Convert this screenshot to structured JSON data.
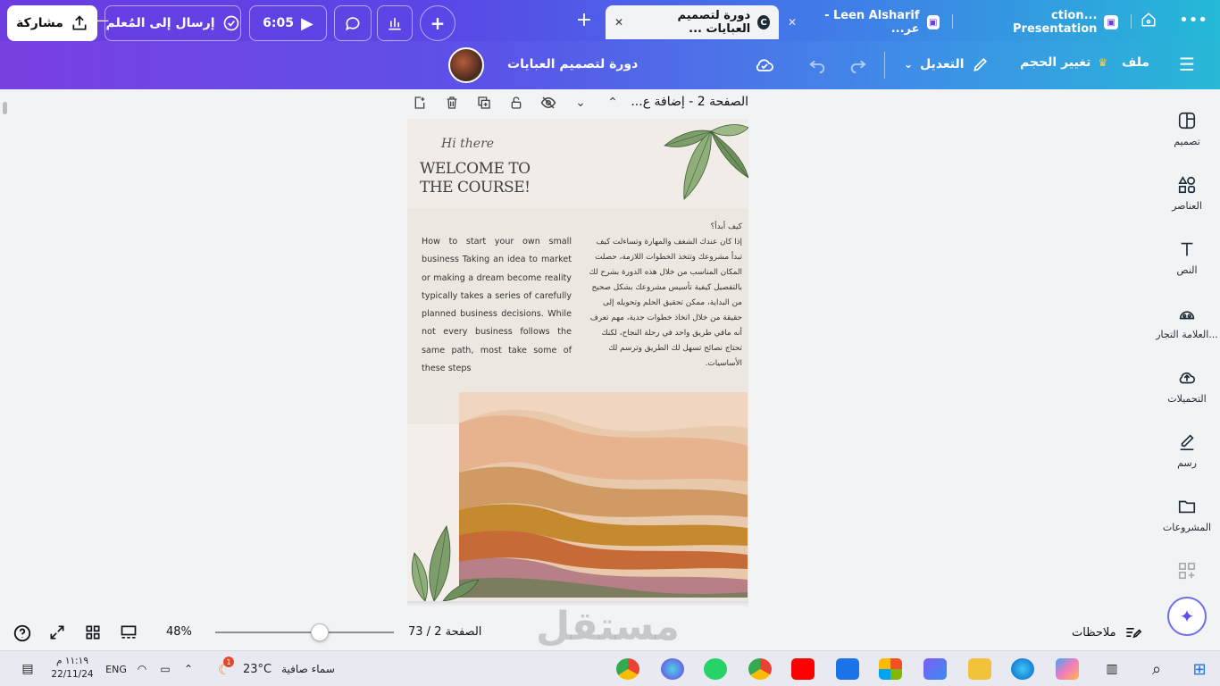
{
  "window": {
    "tabs": [
      {
        "label": "دورة لتصميم العبايات ...",
        "active": true
      },
      {
        "label": "Leen Alsharif - عر...",
        "active": false
      },
      {
        "label": "...ction Presentation",
        "active": false
      }
    ]
  },
  "toolbar": {
    "menu_label": "ملف",
    "resize_label": "تغيير الحجم",
    "edit_label": "التعديل",
    "doc_title": "دورة لتصميم العبايات",
    "timer_label": "6:05",
    "send_label": "إرسال إلى المُعلم",
    "share_label": "مشاركة"
  },
  "sidebar": {
    "items": [
      {
        "label": "تصميم",
        "icon": "design-icon"
      },
      {
        "label": "العناصر",
        "icon": "elements-icon"
      },
      {
        "label": "النص",
        "icon": "text-icon"
      },
      {
        "label": "العلامة التجار...",
        "icon": "brand-icon"
      },
      {
        "label": "التحميلات",
        "icon": "upload-icon"
      },
      {
        "label": "رسم",
        "icon": "draw-icon"
      },
      {
        "label": "المشروعات",
        "icon": "folder-icon"
      }
    ]
  },
  "page_header": {
    "label": "الصفحة 2 - إضافة ع..."
  },
  "design": {
    "hi_there": "Hi there",
    "welcome_line1": "WELCOME TO",
    "welcome_line2": "THE COURSE!",
    "english_body": "How to start your own small business Taking an idea to market or making a dream become reality typically takes a series of carefully planned business decisions. While not every business follows the same path, most take some of these steps",
    "arabic_title": "كيف أبدأ؟",
    "arabic_body": "إذا كان عندك الشغف والمهارة وتساءلت كيف تبدأ مشروعك وتتخذ الخطوات اللازمة، حصلت المكان المناسب من خلال هذه الدورة بشرح لك بالتفصيل كيفية تأسيس مشروعك بشكل صحيح من البداية، ممكن تحقيق الحلم وتحويله إلى حقيقة من خلال اتخاذ خطوات جدية، مهم تعرف أنه مافي طريق واحد في رحلة النجاح، لكنك تحتاج نصائح تسهل لك الطريق وترسم لك الأساسيات."
  },
  "status": {
    "notes_label": "ملاحظات",
    "page_counter": "الصفحة 2 / 73",
    "zoom": "48%",
    "zoom_fraction": 0.48
  },
  "taskbar": {
    "time": "١١:١٩ م",
    "date": "22/11/24",
    "lang": "ENG",
    "weather_text": "سماء صافية",
    "temperature": "23°C",
    "weather_badge": "1"
  }
}
